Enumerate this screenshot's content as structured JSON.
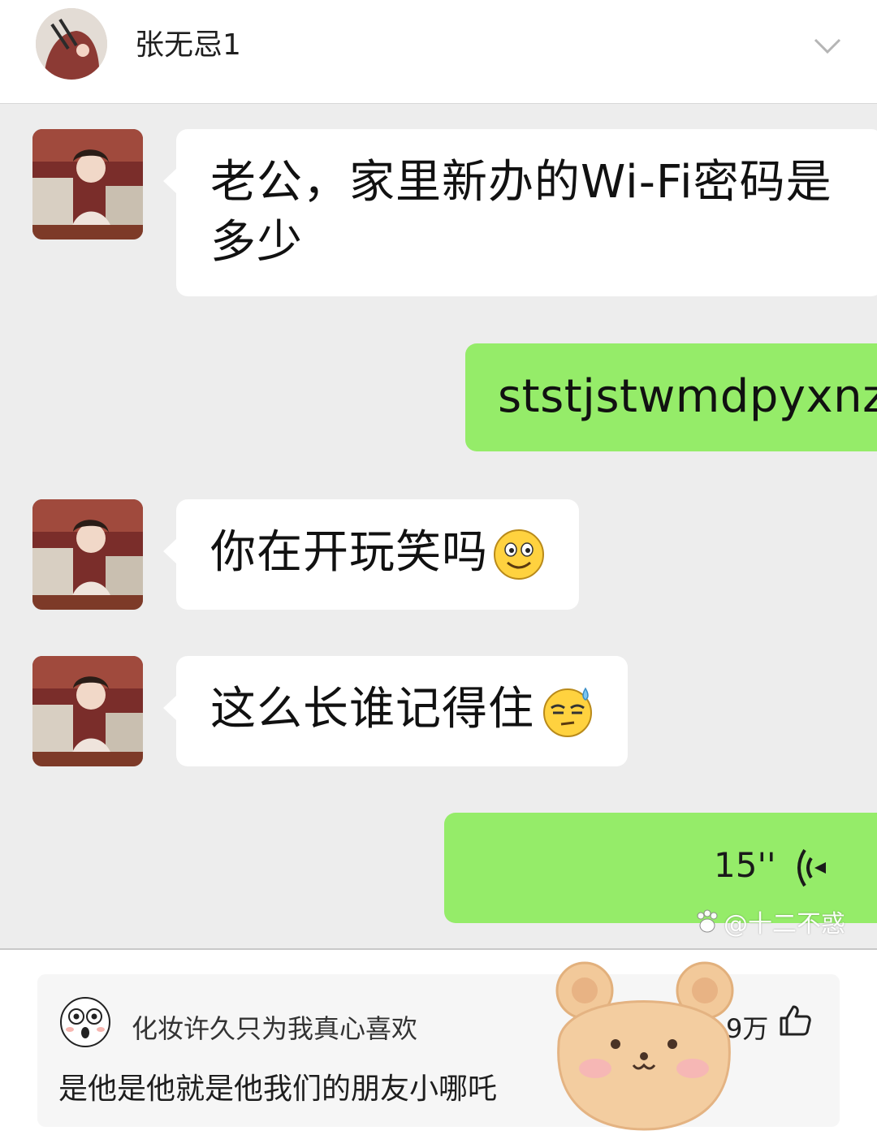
{
  "post": {
    "author_name": "张无忌1"
  },
  "chat": {
    "messages": [
      {
        "side": "left",
        "type": "text",
        "lines": [
          "老公，家里新办的Wi-Fi密码是",
          "多少"
        ]
      },
      {
        "side": "right",
        "type": "text",
        "text": "ststjstwmdpyxnz"
      },
      {
        "side": "left",
        "type": "text",
        "text": "你在开玩笑吗",
        "emoji": "smile-emoji"
      },
      {
        "side": "left",
        "type": "text",
        "text": "这么长谁记得住",
        "emoji": "sweat-emoji"
      },
      {
        "side": "right",
        "type": "voice",
        "duration": "15''"
      }
    ],
    "watermark": "@十二不惑",
    "colors": {
      "background": "#ededed",
      "sent_bubble": "#95ec69",
      "received_bubble": "#ffffff"
    }
  },
  "comment": {
    "user_name": "化妆许久只为我真心喜欢",
    "text": "是他是他就是他我们的朋友小哪吒",
    "like_count": "9万"
  }
}
